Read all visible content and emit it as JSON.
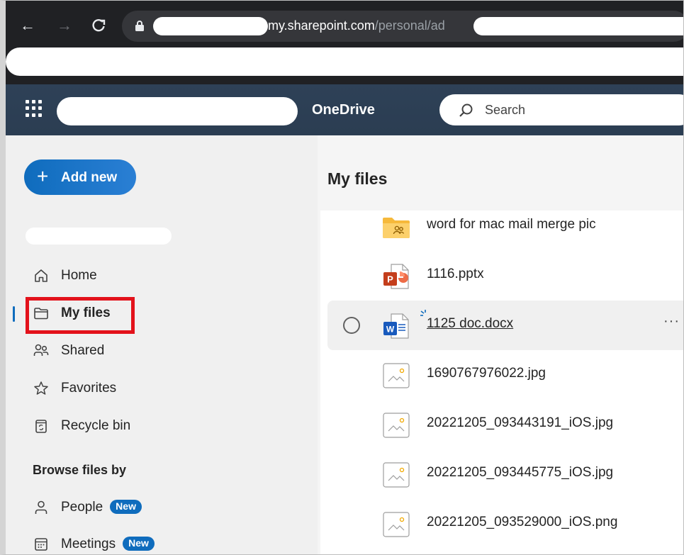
{
  "browser": {
    "url_host": "my.sharepoint.com",
    "url_path": "/personal/ad"
  },
  "header": {
    "app_name": "OneDrive",
    "search_placeholder": "Search"
  },
  "sidebar": {
    "add_new_label": "Add new",
    "items": [
      {
        "label": "Home",
        "icon": "home-icon"
      },
      {
        "label": "My files",
        "icon": "folder-icon",
        "selected": true
      },
      {
        "label": "Shared",
        "icon": "people-icon"
      },
      {
        "label": "Favorites",
        "icon": "star-icon"
      },
      {
        "label": "Recycle bin",
        "icon": "recycle-bin-icon"
      }
    ],
    "browse_header": "Browse files by",
    "browse_items": [
      {
        "label": "People",
        "badge": "New",
        "icon": "person-icon"
      },
      {
        "label": "Meetings",
        "badge": "New",
        "icon": "calendar-icon"
      }
    ]
  },
  "main": {
    "title": "My files",
    "files": [
      {
        "name": "word for mac mail merge pic",
        "type": "shared-folder"
      },
      {
        "name": "1116.pptx",
        "type": "powerpoint"
      },
      {
        "name": "1125 doc.docx",
        "type": "word",
        "active": true
      },
      {
        "name": "1690767976022.jpg",
        "type": "image"
      },
      {
        "name": "20221205_093443191_iOS.jpg",
        "type": "image"
      },
      {
        "name": "20221205_093445775_iOS.jpg",
        "type": "image"
      },
      {
        "name": "20221205_093529000_iOS.png",
        "type": "image"
      }
    ]
  },
  "colors": {
    "accent": "#0f6cbd",
    "header_bg": "#2c3e50",
    "highlight": "#e3121b"
  }
}
